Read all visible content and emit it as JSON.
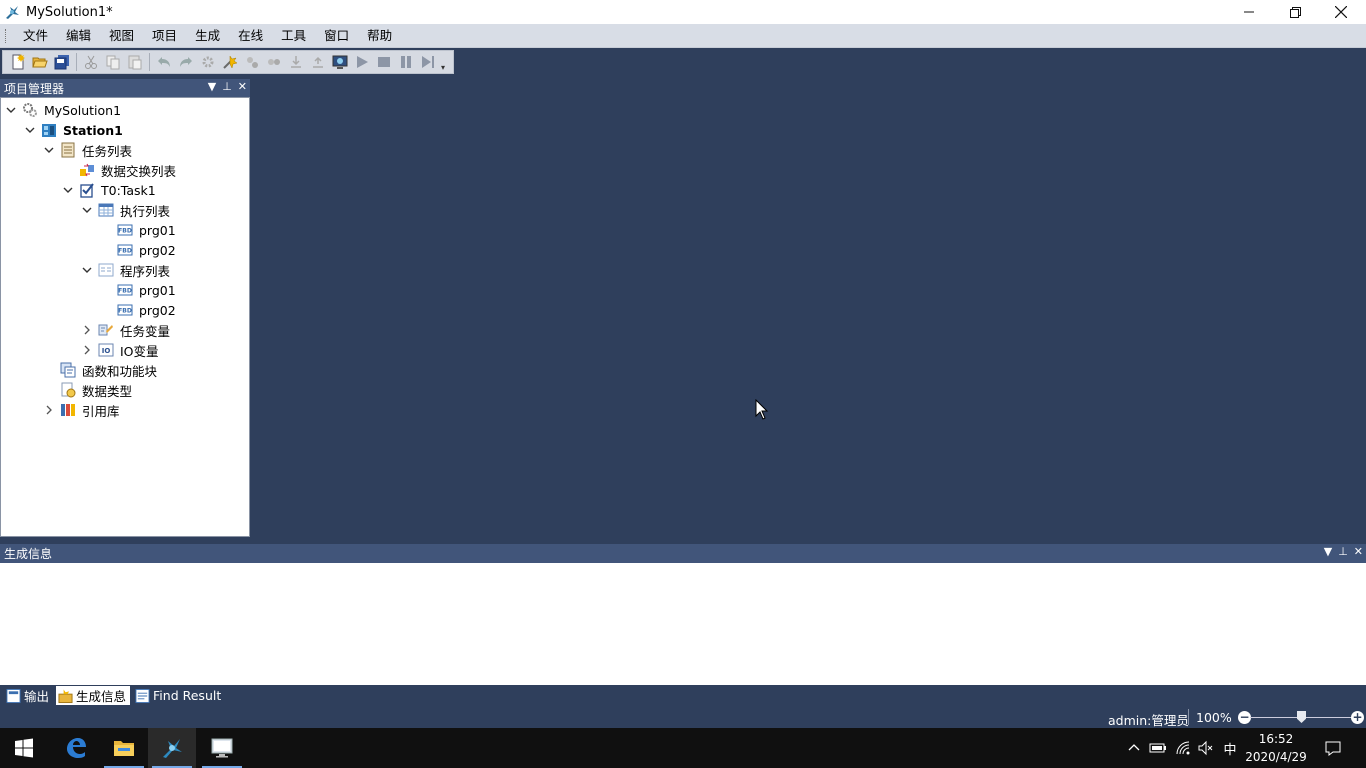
{
  "window": {
    "title": "MySolution1*"
  },
  "menu": [
    "文件",
    "编辑",
    "视图",
    "项目",
    "生成",
    "在线",
    "工具",
    "窗口",
    "帮助"
  ],
  "project_panel": {
    "title": "项目管理器",
    "tree": [
      {
        "label": "MySolution1",
        "level": 0,
        "expander": "expanded",
        "icon": "solution-icon",
        "bold": false
      },
      {
        "label": "Station1",
        "level": 1,
        "expander": "expanded",
        "icon": "station-icon",
        "bold": true
      },
      {
        "label": "任务列表",
        "level": 2,
        "expander": "expanded",
        "icon": "task-list-icon",
        "bold": false
      },
      {
        "label": "数据交换列表",
        "level": 3,
        "expander": "none",
        "icon": "data-exchange-icon",
        "bold": false
      },
      {
        "label": "T0:Task1",
        "level": 3,
        "expander": "expanded",
        "icon": "task-icon",
        "bold": false
      },
      {
        "label": "执行列表",
        "level": 4,
        "expander": "expanded",
        "icon": "exec-list-icon",
        "bold": false
      },
      {
        "label": "prg01",
        "level": 5,
        "expander": "none",
        "icon": "fbd-program-icon",
        "bold": false
      },
      {
        "label": "prg02",
        "level": 5,
        "expander": "none",
        "icon": "fbd-program-icon",
        "bold": false
      },
      {
        "label": "程序列表",
        "level": 4,
        "expander": "expanded",
        "icon": "program-list-icon",
        "bold": false
      },
      {
        "label": "prg01",
        "level": 5,
        "expander": "none",
        "icon": "fbd-program-icon",
        "bold": false
      },
      {
        "label": "prg02",
        "level": 5,
        "expander": "none",
        "icon": "fbd-program-icon",
        "bold": false
      },
      {
        "label": "任务变量",
        "level": 4,
        "expander": "collapsed",
        "icon": "task-variable-icon",
        "bold": false
      },
      {
        "label": "IO变量",
        "level": 4,
        "expander": "collapsed",
        "icon": "io-variable-icon",
        "bold": false
      },
      {
        "label": "函数和功能块",
        "level": 2,
        "expander": "none",
        "icon": "function-block-icon",
        "bold": false
      },
      {
        "label": "数据类型",
        "level": 2,
        "expander": "none",
        "icon": "data-type-icon",
        "bold": false
      },
      {
        "label": "引用库",
        "level": 2,
        "expander": "collapsed",
        "icon": "library-icon",
        "bold": false
      }
    ]
  },
  "output_panel": {
    "title": "生成信息"
  },
  "bottom_tabs": [
    {
      "label": "输出",
      "icon": "output-icon",
      "active": false
    },
    {
      "label": "生成信息",
      "icon": "build-info-icon",
      "active": true
    },
    {
      "label": "Find Result",
      "icon": "find-result-icon",
      "active": false
    }
  ],
  "status": {
    "user": "admin:管理员",
    "zoom": "100%",
    "zoom_fraction": 0.5
  },
  "taskbar": {
    "time": "16:52",
    "date": "2020/4/29",
    "ime": "中"
  },
  "colors": {
    "background": "#2f3f5c",
    "panel_header": "#41557a",
    "menubar": "#d8dde6"
  }
}
